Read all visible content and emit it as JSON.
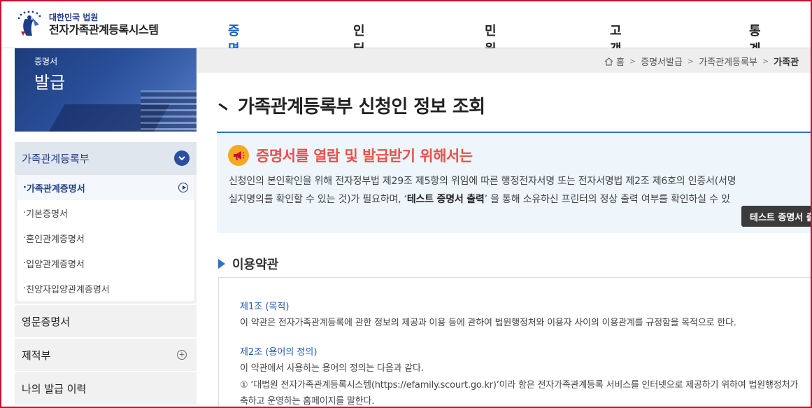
{
  "header": {
    "org": "대한민국 법원",
    "system_name": "전자가족관계등록시스템",
    "nav": [
      "증명서발급",
      "인터넷신고",
      "민원안내",
      "고객센터",
      "통계"
    ],
    "active_nav": "증명서발급"
  },
  "sidebar": {
    "banner": {
      "line1": "증명서",
      "line2": "발급"
    },
    "group_title": "가족관계등록부",
    "sub_items": [
      "가족관계증명서",
      "기본증명서",
      "혼인관계증명서",
      "입양관계증명서",
      "친양자입양관계증명서"
    ],
    "active_sub_item": "가족관계증명서",
    "main_items": [
      "영문증명서",
      "제적부",
      "나의 발급 이력"
    ]
  },
  "breadcrumb": {
    "home": "홈",
    "items": [
      "증명서발급",
      "가족관계등록부",
      "가족관"
    ]
  },
  "page_title": "가족관계등록부 신청인 정보 조회",
  "notice": {
    "title": "증명서를 열람 및 발급받기 위해서는",
    "line1": "신청인의 본인확인을 위해 전자정부법 제29조 제5항의 위임에 따른 행정전자서명 또는 전자서명법 제2조 제6호의 인증서(서명",
    "line2_pre": "실지명의를 확인할 수 있는 것)가 필요하며, ‘",
    "line2_bold": "테스트 증명서 출력",
    "line2_post": "’ 을 통해 소유하신 프린터의 정상 출력 여부를 확인하실 수 있",
    "test_button": "테스트 증명서 출"
  },
  "terms_section": {
    "title": "이용약관",
    "article1_title": "제1조 (목적)",
    "article1_text": "이 약관은 전자가족관계등록에 관한 정보의 제공과 이용 등에 관하여 법원행정처와 이용자 사이의 이용관계를 규정함을 목적으로 한다.",
    "article2_title": "제2조 (용어의 정의)",
    "article2_text": "이 약관에서 사용하는 용어의 정의는 다음과 같다.",
    "article2_item1": "① ‘대법원 전자가족관계등록시스템(https://efamily.scourt.go.kr)’이라 함은 전자가족관계등록 서비스를 인터넷으로 제공하기 위하여 법원행정처가",
    "article2_item1_cont": "축하고 운영하는 홈페이지를 말한다."
  },
  "colors": {
    "accent": "#1b5fd0",
    "notice_title": "#e8514a",
    "frame": "#c8102e"
  }
}
